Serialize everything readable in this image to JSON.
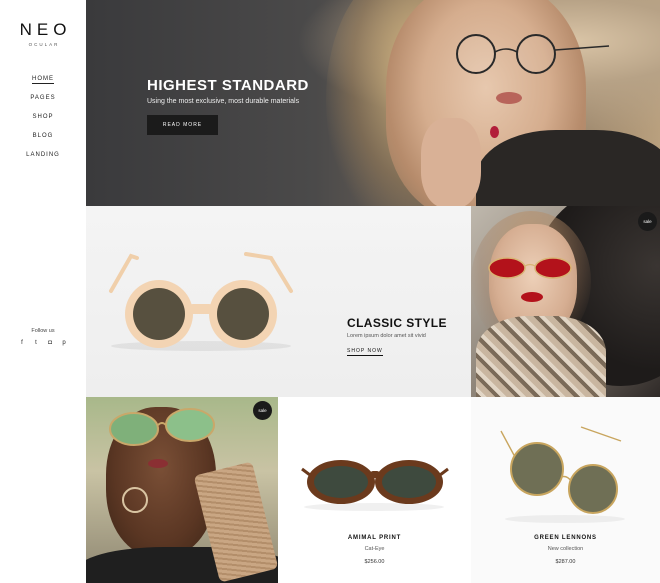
{
  "brand": {
    "logo": "NEO",
    "tagline": "OCULAR"
  },
  "nav": {
    "items": [
      "HOME",
      "PAGES",
      "SHOP",
      "BLOG",
      "LANDING"
    ],
    "active": "HOME"
  },
  "social": {
    "label": "Follow us",
    "icons": [
      "facebook-icon",
      "twitter-icon",
      "instagram-icon",
      "pinterest-icon"
    ],
    "glyphs": [
      "f",
      "t",
      "◘",
      "p"
    ]
  },
  "hero": {
    "title": "HIGHEST STANDARD",
    "subtitle": "Using the most exclusive, most durable materials",
    "button": "READ MORE"
  },
  "classic": {
    "title": "CLASSIC STYLE",
    "subtitle": "Lorem ipsum dolor amet sit vivid",
    "link": "SHOP NOW"
  },
  "badges": {
    "sale": "sale"
  },
  "products": [
    {
      "name": "AMIMAL PRINT",
      "category": "Cat-Eye",
      "price": "$256.00"
    },
    {
      "name": "GREEN LENNONS",
      "category": "New collection",
      "price": "$287.00"
    }
  ],
  "colors": {
    "dark": "#1b1b1b",
    "accent_red": "#b3121b"
  }
}
